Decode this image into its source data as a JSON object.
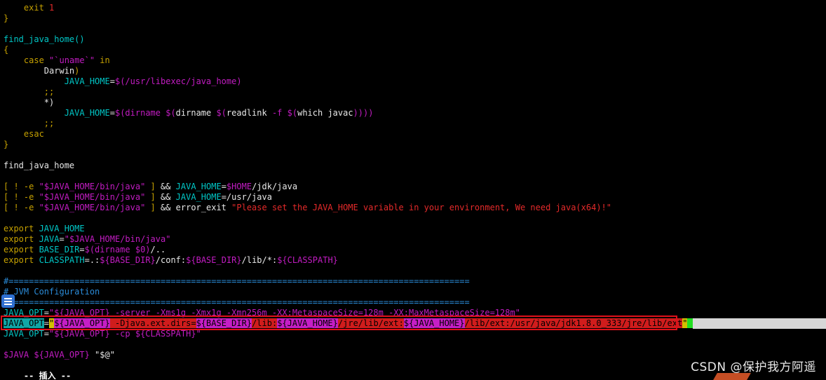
{
  "editor": {
    "lines": [
      {
        "indent": "    ",
        "tokens": [
          {
            "t": "exit ",
            "c": "t-kw"
          },
          {
            "t": "1",
            "c": "t-num"
          }
        ]
      },
      {
        "indent": "",
        "tokens": [
          {
            "t": "}",
            "c": "t-kw"
          }
        ]
      },
      {
        "indent": "",
        "tokens": []
      },
      {
        "indent": "",
        "tokens": [
          {
            "t": "find_java_home()",
            "c": "t-var"
          }
        ]
      },
      {
        "indent": "",
        "tokens": [
          {
            "t": "{",
            "c": "t-kw"
          }
        ]
      },
      {
        "indent": "    ",
        "tokens": [
          {
            "t": "case ",
            "c": "t-kw"
          },
          {
            "t": "\"`uname`\"",
            "c": "t-str"
          },
          {
            "t": " in",
            "c": "t-kw"
          }
        ]
      },
      {
        "indent": "        ",
        "tokens": [
          {
            "t": "Darwin",
            "c": "t-text"
          },
          {
            "t": ")",
            "c": "t-kw"
          }
        ]
      },
      {
        "indent": "            ",
        "tokens": [
          {
            "t": "JAVA_HOME",
            "c": "t-var"
          },
          {
            "t": "=",
            "c": "t-text"
          },
          {
            "t": "$(/usr/libexec/java_home)",
            "c": "t-str"
          }
        ]
      },
      {
        "indent": "        ",
        "tokens": [
          {
            "t": ";;",
            "c": "t-kw"
          }
        ]
      },
      {
        "indent": "        ",
        "tokens": [
          {
            "t": "*)",
            "c": "t-text"
          }
        ]
      },
      {
        "indent": "            ",
        "tokens": [
          {
            "t": "JAVA_HOME",
            "c": "t-var"
          },
          {
            "t": "=",
            "c": "t-text"
          },
          {
            "t": "$(",
            "c": "t-str"
          },
          {
            "t": "dirname ",
            "c": "t-str"
          },
          {
            "t": "$(",
            "c": "t-str"
          },
          {
            "t": "dirname ",
            "c": "t-text"
          },
          {
            "t": "$(",
            "c": "t-str"
          },
          {
            "t": "readlink ",
            "c": "t-text"
          },
          {
            "t": "-f ",
            "c": "t-str"
          },
          {
            "t": "$(",
            "c": "t-str"
          },
          {
            "t": "which javac",
            "c": "t-text"
          },
          {
            "t": "))))",
            "c": "t-str"
          }
        ]
      },
      {
        "indent": "        ",
        "tokens": [
          {
            "t": ";;",
            "c": "t-kw"
          }
        ]
      },
      {
        "indent": "    ",
        "tokens": [
          {
            "t": "esac",
            "c": "t-kw"
          }
        ]
      },
      {
        "indent": "",
        "tokens": [
          {
            "t": "}",
            "c": "t-kw"
          }
        ]
      },
      {
        "indent": "",
        "tokens": []
      },
      {
        "indent": "",
        "tokens": [
          {
            "t": "find_java_home",
            "c": "t-text"
          }
        ]
      },
      {
        "indent": "",
        "tokens": []
      },
      {
        "indent": "",
        "tokens": [
          {
            "t": "[ ! -e ",
            "c": "t-kw"
          },
          {
            "t": "\"$JAVA_HOME/bin/java\"",
            "c": "t-str"
          },
          {
            "t": " ] ",
            "c": "t-kw"
          },
          {
            "t": "&& ",
            "c": "t-text"
          },
          {
            "t": "JAVA_HOME",
            "c": "t-var"
          },
          {
            "t": "=",
            "c": "t-text"
          },
          {
            "t": "$HOME",
            "c": "t-str"
          },
          {
            "t": "/jdk/java",
            "c": "t-text"
          }
        ]
      },
      {
        "indent": "",
        "tokens": [
          {
            "t": "[ ! -e ",
            "c": "t-kw"
          },
          {
            "t": "\"$JAVA_HOME/bin/java\"",
            "c": "t-str"
          },
          {
            "t": " ] ",
            "c": "t-kw"
          },
          {
            "t": "&& ",
            "c": "t-text"
          },
          {
            "t": "JAVA_HOME",
            "c": "t-var"
          },
          {
            "t": "=/usr/java",
            "c": "t-text"
          }
        ]
      },
      {
        "indent": "",
        "tokens": [
          {
            "t": "[ ! -e ",
            "c": "t-kw"
          },
          {
            "t": "\"$JAVA_HOME/bin/java\"",
            "c": "t-str"
          },
          {
            "t": " ] ",
            "c": "t-kw"
          },
          {
            "t": "&& error_exit ",
            "c": "t-text"
          },
          {
            "t": "\"Please set the JAVA_HOME variable in your environment, We need java(x64)!\"",
            "c": "t-err"
          }
        ]
      },
      {
        "indent": "",
        "tokens": []
      },
      {
        "indent": "",
        "tokens": [
          {
            "t": "export ",
            "c": "t-kw"
          },
          {
            "t": "JAVA_HOME",
            "c": "t-var"
          }
        ]
      },
      {
        "indent": "",
        "tokens": [
          {
            "t": "export ",
            "c": "t-kw"
          },
          {
            "t": "JAVA",
            "c": "t-var"
          },
          {
            "t": "=",
            "c": "t-text"
          },
          {
            "t": "\"$JAVA_HOME/bin/java\"",
            "c": "t-str"
          }
        ]
      },
      {
        "indent": "",
        "tokens": [
          {
            "t": "export ",
            "c": "t-kw"
          },
          {
            "t": "BASE_DIR",
            "c": "t-var"
          },
          {
            "t": "=",
            "c": "t-text"
          },
          {
            "t": "$(dirname $0)",
            "c": "t-str"
          },
          {
            "t": "/..",
            "c": "t-text"
          }
        ]
      },
      {
        "indent": "",
        "tokens": [
          {
            "t": "export ",
            "c": "t-kw"
          },
          {
            "t": "CLASSPATH",
            "c": "t-var"
          },
          {
            "t": "=.:",
            "c": "t-text"
          },
          {
            "t": "${BASE_DIR}",
            "c": "t-str"
          },
          {
            "t": "/conf:",
            "c": "t-text"
          },
          {
            "t": "${BASE_DIR}",
            "c": "t-str"
          },
          {
            "t": "/lib/*:",
            "c": "t-text"
          },
          {
            "t": "${CLASSPATH}",
            "c": "t-str"
          }
        ]
      },
      {
        "indent": "",
        "tokens": []
      },
      {
        "indent": "",
        "tokens": [
          {
            "t": "#===========================================================================================",
            "c": "t-comment"
          }
        ]
      },
      {
        "indent": "",
        "tokens": [
          {
            "t": "# JVM Configuration",
            "c": "t-comment"
          }
        ]
      },
      {
        "indent": "",
        "tokens": [
          {
            "t": "#===========================================================================================",
            "c": "t-comment"
          }
        ]
      },
      {
        "indent": "",
        "tokens": [
          {
            "t": "JAVA_OPT",
            "c": "t-var"
          },
          {
            "t": "=",
            "c": "t-text"
          },
          {
            "t": "\"${JAVA_OPT} -server -Xms1g -Xmx1g -Xmn256m -XX:MetaspaceSize=128m -XX:MaxMetaspaceSize=128m\"",
            "c": "t-str"
          }
        ]
      },
      {
        "indent": "",
        "highlight": true,
        "tokens": [
          {
            "t": "JAVA_OPT",
            "c": "hl-var"
          },
          {
            "t": "=",
            "c": "t-text"
          },
          {
            "t": "\"",
            "c": "hl-yel"
          },
          {
            "t": "${JAVA_OPT}",
            "c": "hl-mag"
          },
          {
            "t": " -Djava.ext.dirs=",
            "c": "hl-str"
          },
          {
            "t": "${BASE_DIR}",
            "c": "hl-mag"
          },
          {
            "t": "/lib:",
            "c": "hl-str"
          },
          {
            "t": "${JAVA_HOME}",
            "c": "hl-mag"
          },
          {
            "t": "/jre/lib/ext:",
            "c": "hl-str"
          },
          {
            "t": "${JAVA_HOME}",
            "c": "hl-mag"
          },
          {
            "t": "/lib/ext:/usr/java/jdk1.8.0_333/jre/lib/ext",
            "c": "hl-str"
          },
          {
            "t": "\"",
            "c": "hl-yel"
          },
          {
            "t": " ",
            "c": "hl-cursor"
          }
        ]
      },
      {
        "indent": "",
        "tokens": [
          {
            "t": "JAVA_OPT",
            "c": "t-var"
          },
          {
            "t": "=",
            "c": "t-text"
          },
          {
            "t": "\"${JAVA_OPT} -cp ${CLASSPATH}\"",
            "c": "t-str"
          }
        ]
      },
      {
        "indent": "",
        "tokens": []
      },
      {
        "indent": "",
        "tokens": [
          {
            "t": "$JAVA ${JAVA_OPT} ",
            "c": "t-str"
          },
          {
            "t": "\"$@\"",
            "c": "t-text"
          }
        ]
      }
    ],
    "mode_label": "-- 插入 --"
  },
  "watermark": "CSDN @保护我方阿遥",
  "colors": {
    "background": "#000000",
    "keyword": "#c5a000",
    "variable": "#00c6c6",
    "string": "#c21cc2",
    "comment": "#2a8bd8",
    "error": "#e52a2a",
    "highlight_box": "#e0101a"
  }
}
